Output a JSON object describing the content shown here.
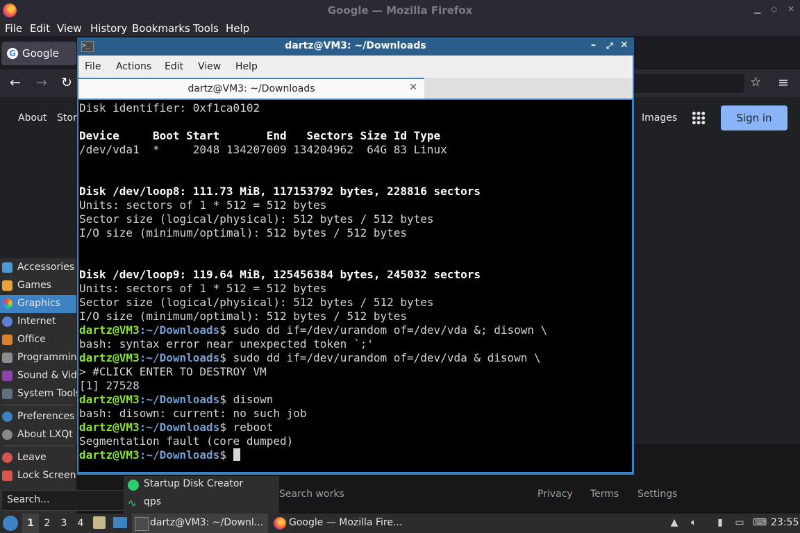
{
  "firefox": {
    "title": "Google — Mozilla Firefox",
    "menu": [
      "File",
      "Edit",
      "View",
      "History",
      "Bookmarks",
      "Tools",
      "Help"
    ],
    "tab_label": "Google",
    "google": {
      "about": "About",
      "store": "Store",
      "images": "Images",
      "sign_in": "Sign in",
      "footer": {
        "search_works": "Search works",
        "privacy": "Privacy",
        "terms": "Terms",
        "settings": "Settings"
      }
    }
  },
  "launcher_menu": {
    "categories": [
      "Accessories",
      "Games",
      "Graphics",
      "Internet",
      "Office",
      "Programming",
      "Sound & Video",
      "System Tools"
    ],
    "selected": "Graphics",
    "extras": [
      "Preferences",
      "About LXQt"
    ],
    "session": [
      "Leave",
      "Lock Screen"
    ],
    "search_placeholder": "Search...",
    "apps": [
      "Startup Disk Creator",
      "qps"
    ]
  },
  "terminal": {
    "title": "dartz@VM3: ~/Downloads",
    "menu": [
      "File",
      "Actions",
      "Edit",
      "View",
      "Help"
    ],
    "tab_label": "dartz@VM3: ~/Downloads",
    "prompt_user": "dartz@VM3",
    "prompt_path": ":~/Downloads",
    "lines": [
      {
        "kind": "text",
        "text": "Disk identifier: 0xf1ca0102"
      },
      {
        "kind": "blank",
        "text": ""
      },
      {
        "kind": "bold",
        "text": "Device     Boot Start       End   Sectors Size Id Type"
      },
      {
        "kind": "text",
        "text": "/dev/vda1  *     2048 134207009 134204962  64G 83 Linux"
      },
      {
        "kind": "blank",
        "text": ""
      },
      {
        "kind": "blank",
        "text": ""
      },
      {
        "kind": "bold",
        "text": "Disk /dev/loop8: 111.73 MiB, 117153792 bytes, 228816 sectors"
      },
      {
        "kind": "text",
        "text": "Units: sectors of 1 * 512 = 512 bytes"
      },
      {
        "kind": "text",
        "text": "Sector size (logical/physical): 512 bytes / 512 bytes"
      },
      {
        "kind": "text",
        "text": "I/O size (minimum/optimal): 512 bytes / 512 bytes"
      },
      {
        "kind": "blank",
        "text": ""
      },
      {
        "kind": "blank",
        "text": ""
      },
      {
        "kind": "bold",
        "text": "Disk /dev/loop9: 119.64 MiB, 125456384 bytes, 245032 sectors"
      },
      {
        "kind": "text",
        "text": "Units: sectors of 1 * 512 = 512 bytes"
      },
      {
        "kind": "text",
        "text": "Sector size (logical/physical): 512 bytes / 512 bytes"
      },
      {
        "kind": "text",
        "text": "I/O size (minimum/optimal): 512 bytes / 512 bytes"
      },
      {
        "kind": "prompt",
        "text": "$ sudo dd if=/dev/urandom of=/dev/vda &; disown \\"
      },
      {
        "kind": "text",
        "text": "bash: syntax error near unexpected token `;'"
      },
      {
        "kind": "prompt",
        "text": "$ sudo dd if=/dev/urandom of=/dev/vda & disown \\"
      },
      {
        "kind": "text",
        "text": "> #CLICK ENTER TO DESTROY VM"
      },
      {
        "kind": "text",
        "text": "[1] 27528"
      },
      {
        "kind": "prompt",
        "text": "$ disown"
      },
      {
        "kind": "text",
        "text": "bash: disown: current: no such job"
      },
      {
        "kind": "prompt",
        "text": "$ reboot"
      },
      {
        "kind": "text",
        "text": "Segmentation fault (core dumped)"
      },
      {
        "kind": "prompt_cursor",
        "text": "$ "
      }
    ]
  },
  "taskbar": {
    "workspaces": [
      "1",
      "2",
      "3",
      "4"
    ],
    "active_workspace": "1",
    "tasks": [
      {
        "label": "dartz@VM3: ~/Downl...",
        "icon": "terminal-icon"
      },
      {
        "label": "Google — Mozilla Fire...",
        "icon": "firefox-icon"
      }
    ],
    "clock": "23:55"
  }
}
